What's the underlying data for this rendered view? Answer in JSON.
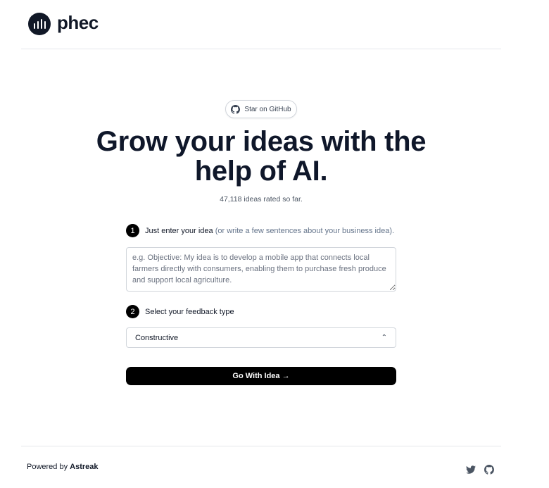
{
  "header": {
    "brand": "phec",
    "logo_icon": "bar-chart-logo-icon"
  },
  "github_pill": {
    "label": "Star on GitHub",
    "icon": "github-icon"
  },
  "hero": {
    "line1": "Grow your ideas with the",
    "line2": "help of AI."
  },
  "counter": "47,118 ideas rated so far.",
  "step1": {
    "number": "1",
    "label": "Just enter your idea",
    "hint": "(or write a few sentences about your business idea)."
  },
  "idea_input": {
    "value": "",
    "placeholder": "e.g. Objective: My idea is to develop a mobile app that connects local farmers directly with consumers, enabling them to purchase fresh produce and support local agriculture."
  },
  "step2": {
    "number": "2",
    "label": "Select your feedback type"
  },
  "feedback_select": {
    "selected": "Constructive",
    "icon": "chevron-up-icon"
  },
  "submit_button": {
    "label": "Go With Idea →"
  },
  "footer": {
    "powered_prefix": "Powered by",
    "powered_brand": "Astreak",
    "icons": [
      "twitter-icon",
      "github-icon"
    ]
  },
  "colors": {
    "primary": "#000000",
    "text": "#0f172a",
    "muted": "#64748b",
    "border": "#d1d5db"
  }
}
